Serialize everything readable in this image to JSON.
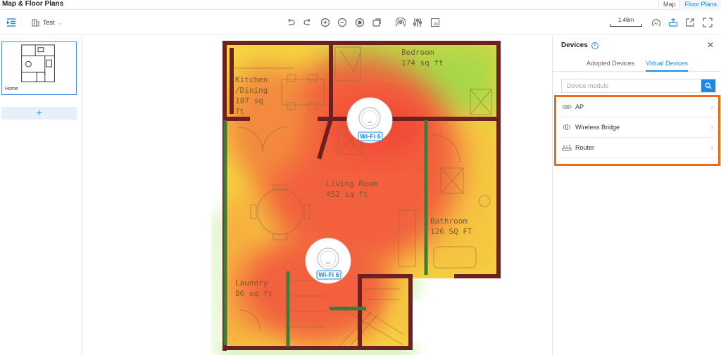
{
  "app": {
    "title": "Map & Floor Plans"
  },
  "top_nav": [
    {
      "label": "Map",
      "active": false
    },
    {
      "label": "Floor Plans",
      "active": true
    }
  ],
  "toolbar": {
    "site_select": "Test",
    "scale_label": "1.46m",
    "icons": [
      "list-indent-icon",
      "building-icon",
      "undo-icon",
      "redo-icon",
      "zoom-in-icon",
      "zoom-out-icon",
      "locate-icon",
      "fit-icon",
      "signal-icon",
      "adjust-icon",
      "ai-icon",
      "ai-text-icon",
      "router-icon",
      "export-icon",
      "fullscreen-icon"
    ]
  },
  "left_panel": {
    "floors": [
      {
        "label": "Home",
        "selected": true
      }
    ],
    "add_label": "+"
  },
  "floor_plan": {
    "rooms": [
      {
        "name": "Bedroom",
        "area": "174 sq ft"
      },
      {
        "name": "Kitchen",
        "name2": "/Dining",
        "area": "187 sq",
        "area2": "ft"
      },
      {
        "name": "Living Room",
        "area": "452 sq ft"
      },
      {
        "name": "Bathroom",
        "area": "126 SQ FT"
      },
      {
        "name": "Laundry",
        "area": "86 sq ft"
      }
    ],
    "access_points": [
      {
        "label": "Wi-Fi 6"
      },
      {
        "label": "Wi-Fi 6"
      }
    ],
    "colors": {
      "wall": "#6e1f1f",
      "door": "#3a7d3a",
      "hot": "#f2603c",
      "warm": "#f5b43a",
      "cool": "#8fd84a"
    }
  },
  "right_panel": {
    "title": "Devices",
    "tabs": [
      {
        "label": "Adopted Devices",
        "active": false
      },
      {
        "label": "Virtual Devices",
        "active": true
      }
    ],
    "search_placeholder": "Device module",
    "devices": [
      {
        "label": "AP",
        "icon": "ap-icon"
      },
      {
        "label": "Wireless Bridge",
        "icon": "wireless-bridge-icon"
      },
      {
        "label": "Router",
        "icon": "router-icon"
      }
    ],
    "highlight_color": "#f06a1a"
  }
}
